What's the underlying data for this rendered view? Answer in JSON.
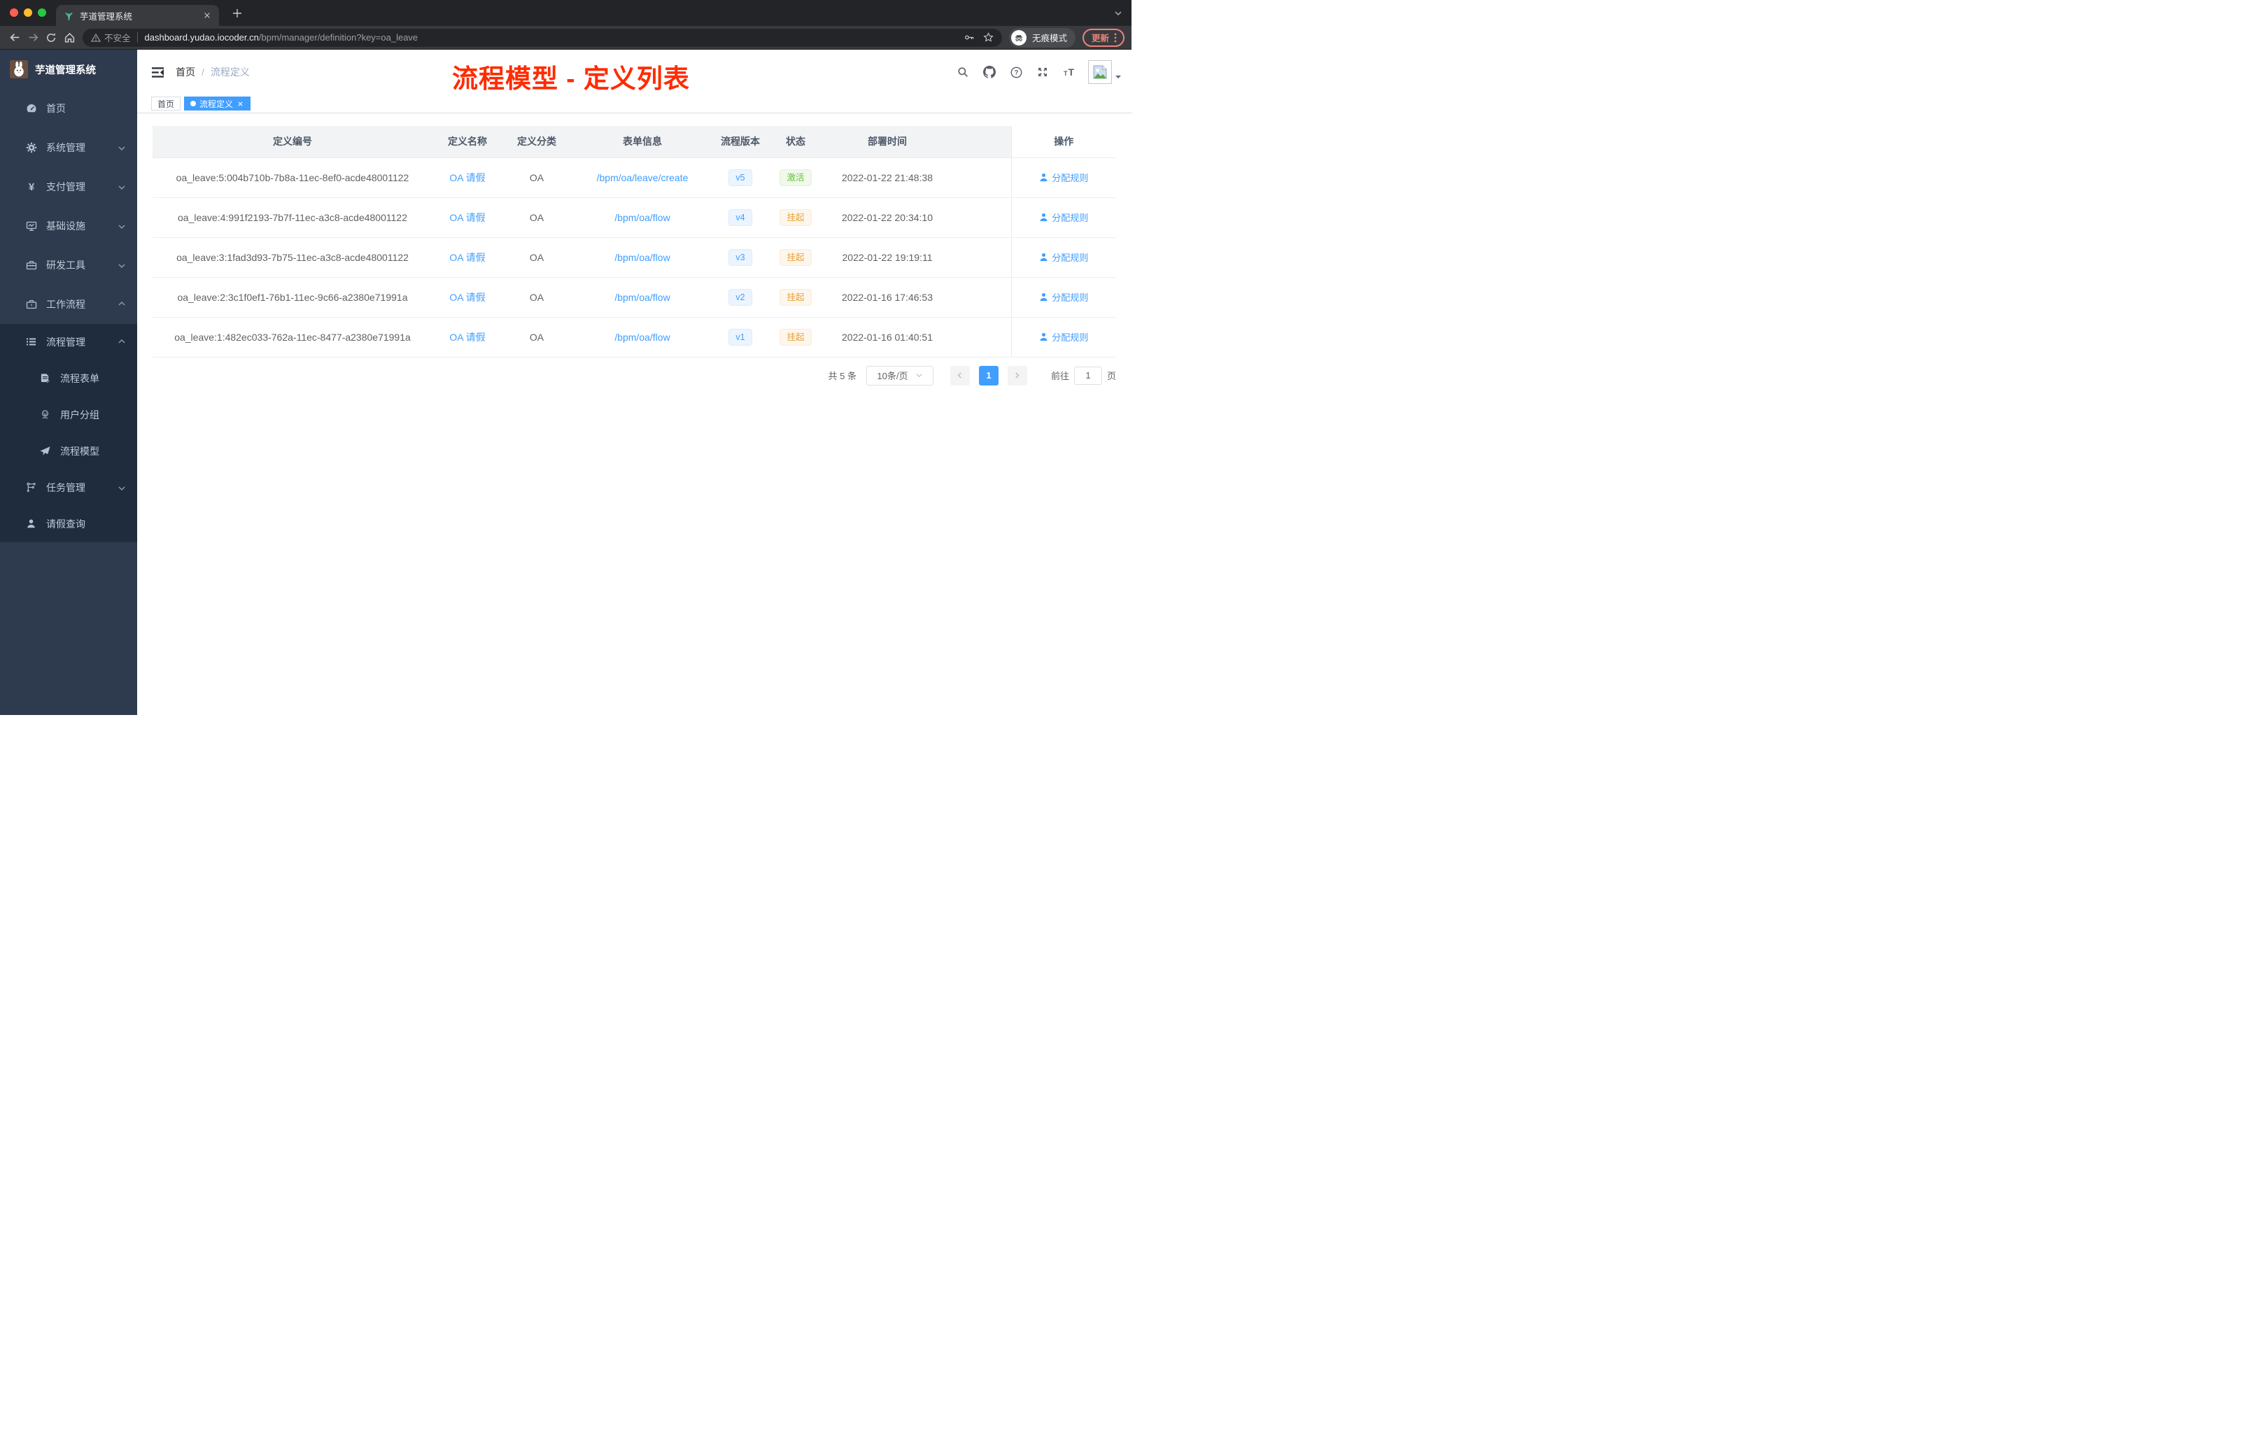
{
  "browser": {
    "tab_title": "芋道管理系统",
    "security_label": "不安全",
    "url_host": "dashboard.yudao.iocoder.cn",
    "url_path": "/bpm/manager/definition?key=oa_leave",
    "incognito_label": "无痕模式",
    "update_label": "更新"
  },
  "sidebar": {
    "logo_title": "芋道管理系统",
    "items": [
      {
        "label": "首页"
      },
      {
        "label": "系统管理"
      },
      {
        "label": "支付管理"
      },
      {
        "label": "基础设施"
      },
      {
        "label": "研发工具"
      },
      {
        "label": "工作流程"
      },
      {
        "label": "流程管理"
      },
      {
        "label": "流程表单"
      },
      {
        "label": "用户分组"
      },
      {
        "label": "流程模型"
      },
      {
        "label": "任务管理"
      },
      {
        "label": "请假查询"
      }
    ]
  },
  "navbar": {
    "breadcrumb_home": "首页",
    "breadcrumb_separator": "/",
    "breadcrumb_current": "流程定义"
  },
  "annotation": {
    "text": "流程模型 - 定义列表",
    "color": "#fe2c02"
  },
  "tags": {
    "home": "首页",
    "active": "流程定义"
  },
  "table": {
    "columns": [
      "定义编号",
      "定义名称",
      "定义分类",
      "表单信息",
      "流程版本",
      "状态",
      "部署时间",
      "操作"
    ],
    "rows": [
      {
        "id": "oa_leave:5:004b710b-7b8a-11ec-8ef0-acde48001122",
        "name": "OA 请假",
        "category": "OA",
        "form": "/bpm/oa/leave/create",
        "version": "v5",
        "status": "激活",
        "status_type": "success",
        "deployed": "2022-01-22 21:48:38",
        "action": "分配规则"
      },
      {
        "id": "oa_leave:4:991f2193-7b7f-11ec-a3c8-acde48001122",
        "name": "OA 请假",
        "category": "OA",
        "form": "/bpm/oa/flow",
        "version": "v4",
        "status": "挂起",
        "status_type": "warning",
        "deployed": "2022-01-22 20:34:10",
        "action": "分配规则"
      },
      {
        "id": "oa_leave:3:1fad3d93-7b75-11ec-a3c8-acde48001122",
        "name": "OA 请假",
        "category": "OA",
        "form": "/bpm/oa/flow",
        "version": "v3",
        "status": "挂起",
        "status_type": "warning",
        "deployed": "2022-01-22 19:19:11",
        "action": "分配规则"
      },
      {
        "id": "oa_leave:2:3c1f0ef1-76b1-11ec-9c66-a2380e71991a",
        "name": "OA 请假",
        "category": "OA",
        "form": "/bpm/oa/flow",
        "version": "v2",
        "status": "挂起",
        "status_type": "warning",
        "deployed": "2022-01-16 17:46:53",
        "action": "分配规则"
      },
      {
        "id": "oa_leave:1:482ec033-762a-11ec-8477-a2380e71991a",
        "name": "OA 请假",
        "category": "OA",
        "form": "/bpm/oa/flow",
        "version": "v1",
        "status": "挂起",
        "status_type": "warning",
        "deployed": "2022-01-16 01:40:51",
        "action": "分配规则"
      }
    ]
  },
  "pagination": {
    "total": "共 5 条",
    "page_size": "10条/页",
    "current_page": "1",
    "goto_label": "前往",
    "goto_value": "1",
    "unit_label": "页"
  },
  "colors": {
    "accent": "#409eff",
    "success": "#67c23a",
    "warning": "#e6a23c",
    "annotation_red": "#fe2c02",
    "sidebar_bg": "#2e3a4e",
    "submenu_bg": "#1f2c3e"
  }
}
